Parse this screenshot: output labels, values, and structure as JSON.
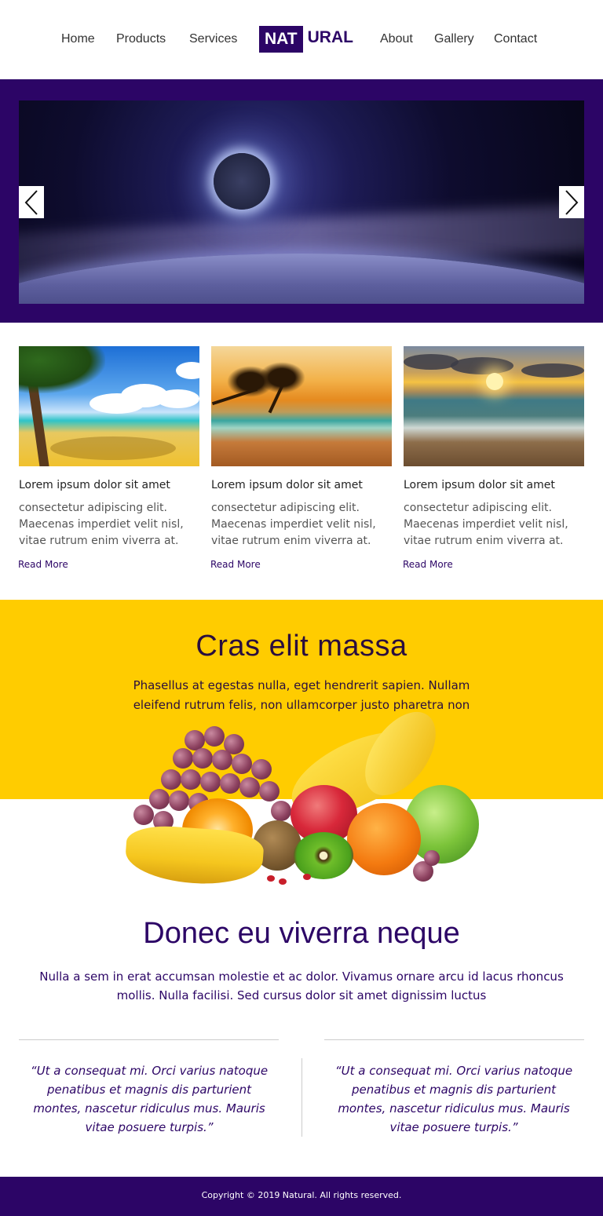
{
  "nav": {
    "items": [
      "Home",
      "Products",
      "Services",
      "About",
      "Gallery",
      "Contact"
    ]
  },
  "logo": {
    "boxed": "NAT",
    "rest": "URAL"
  },
  "colors": {
    "brand": "#2c0566",
    "accent": "#ffcc00",
    "text": "#333333"
  },
  "slider": {
    "prev_icon": "chevron-left-icon",
    "next_icon": "chevron-right-icon"
  },
  "cards": [
    {
      "title": "Lorem ipsum dolor sit amet",
      "text": "consectetur adipiscing elit. Maecenas imperdiet velit nisl, vitae rutrum enim viverra at.",
      "link": "Read More"
    },
    {
      "title": "Lorem ipsum dolor sit amet",
      "text": "consectetur adipiscing elit. Maecenas imperdiet velit nisl, vitae rutrum enim viverra at.",
      "link": "Read More"
    },
    {
      "title": "Lorem ipsum dolor sit amet",
      "text": "consectetur adipiscing elit. Maecenas imperdiet velit nisl, vitae rutrum enim viverra at.",
      "link": "Read More"
    }
  ],
  "feature": {
    "title": "Cras elit massa",
    "text": "Phasellus at egestas nulla, eget hendrerit sapien. Nullam eleifend rutrum felis, non ullamcorper justo pharetra non"
  },
  "section2": {
    "title": "Donec eu viverra neque",
    "text": "Nulla a sem in erat accumsan molestie et ac dolor. Vivamus ornare arcu id lacus rhoncus mollis. Nulla facilisi. Sed cursus dolor sit amet dignissim luctus"
  },
  "quotes": [
    "“Ut a consequat mi. Orci varius natoque penatibus et magnis dis parturient montes, nascetur ridiculus mus. Mauris vitae posuere turpis.”",
    "“Ut a consequat mi. Orci varius natoque penatibus et magnis dis parturient montes, nascetur ridiculus mus. Mauris vitae posuere turpis.”"
  ],
  "footer": {
    "copyright": "Copyright © 2019 Natural. All rights reserved."
  }
}
